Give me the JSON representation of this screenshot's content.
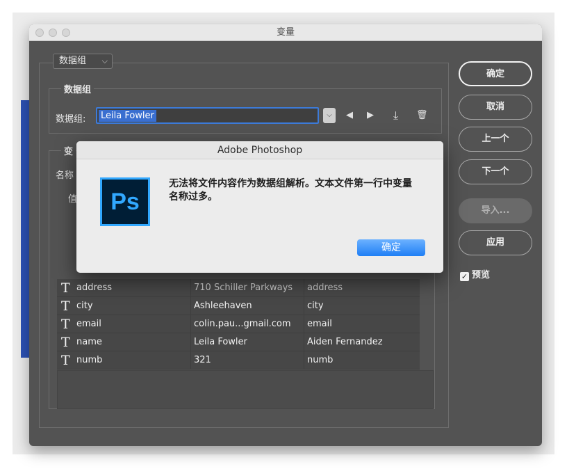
{
  "window": {
    "title": "变量"
  },
  "mode_select": {
    "value": "数据组",
    "chevron": "⌵"
  },
  "dataset_group": {
    "legend": "数据组",
    "field_label": "数据组:",
    "current_value": "Leila Fowler",
    "combo_arrow": "⌵",
    "prev_icon": "◀",
    "next_icon": "▶",
    "import_icon": "⤓",
    "delete_icon": "🗑"
  },
  "variables_group": {
    "legend_partial": "变",
    "name_label_partial": "名称",
    "value_label_partial": "值"
  },
  "buttons": {
    "ok": "确定",
    "cancel": "取消",
    "prev": "上一个",
    "next": "下一个",
    "import": "导入...",
    "apply": "应用"
  },
  "preview": {
    "label": "预览",
    "checked": true,
    "check_glyph": "✓"
  },
  "table": {
    "rows": [
      {
        "type_icon": "T",
        "name": "address",
        "value": "710 Schiller Parkways",
        "alt": "address"
      },
      {
        "type_icon": "T",
        "name": "city",
        "value": "Ashleehaven",
        "alt": "city"
      },
      {
        "type_icon": "T",
        "name": "email",
        "value": "colin.pau...gmail.com",
        "alt": "email"
      },
      {
        "type_icon": "T",
        "name": "name",
        "value": "Leila Fowler",
        "alt": "Aiden Fernandez"
      },
      {
        "type_icon": "T",
        "name": "numb",
        "value": "321",
        "alt": "numb"
      }
    ]
  },
  "alert": {
    "title": "Adobe Photoshop",
    "logo_text": "Ps",
    "message": "无法将文件内容作为数据组解析。文本文件第一行中变量名称过多。",
    "ok": "确定"
  },
  "colors": {
    "window_bg": "#535353",
    "selection_blue": "#3a6fd0",
    "alert_ok_blue": "#1f7ff5",
    "ps_blue": "#31a8ff",
    "ps_dark": "#001e36"
  }
}
